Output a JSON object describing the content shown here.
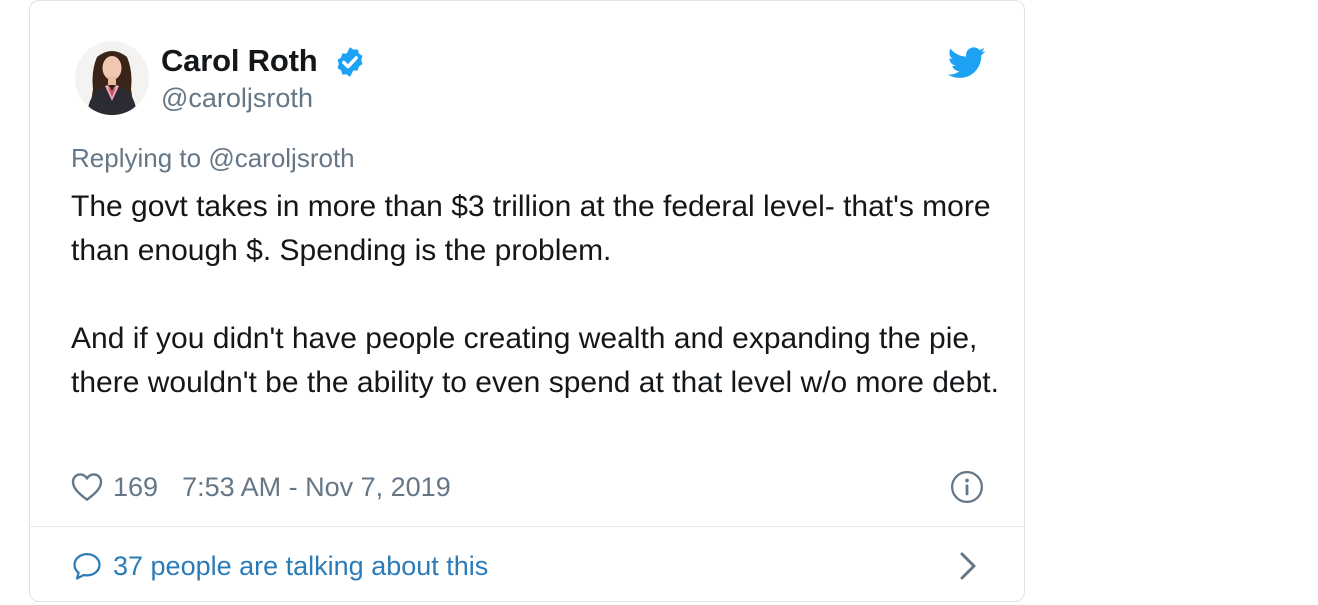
{
  "author": {
    "name": "Carol Roth",
    "handle": "@caroljsroth",
    "verified": true
  },
  "reply": {
    "prefix": "Replying to",
    "to_handle": "@caroljsroth"
  },
  "tweet": {
    "paragraph_1": "The govt takes in more than $3 trillion at the federal level- that's more than enough $. Spending is the problem.",
    "paragraph_2": "And if you didn't have people creating wealth and expanding the pie, there wouldn't be the ability to even spend at that level w/o more debt."
  },
  "meta": {
    "likes": "169",
    "timestamp": "7:53 AM - Nov 7, 2019"
  },
  "talking": {
    "label": "37 people are talking about this"
  },
  "icons": {
    "verified": "verified-badge-icon",
    "logo": "twitter-bird-icon",
    "like": "heart-icon",
    "info": "info-icon",
    "reply": "reply-bubble-icon",
    "chevron": "chevron-right-icon"
  },
  "colors": {
    "twitter_blue": "#1da1f2",
    "link_blue": "#2b7bb9",
    "text_primary": "#14171a",
    "text_secondary": "#657786"
  }
}
